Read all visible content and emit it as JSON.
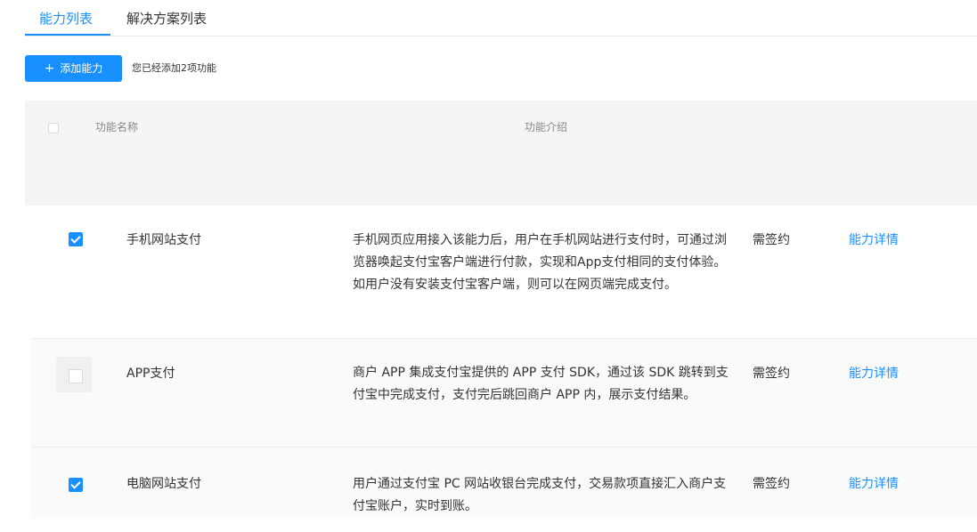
{
  "tabs": [
    {
      "label": "能力列表",
      "active": true
    },
    {
      "label": "解决方案列表",
      "active": false
    }
  ],
  "toolbar": {
    "add_icon": "+",
    "add_label": "添加能力",
    "added_text": "您已经添加2项功能"
  },
  "table": {
    "headers": {
      "name": "功能名称",
      "desc": "功能介绍"
    },
    "rows": [
      {
        "checked": true,
        "name": "手机网站支付",
        "desc": "手机网页应用接入该能力后，用户在手机网站进行支付时，可通过浏览器唤起支付宝客户端进行付款，实现和App支付相同的支付体验。如用户没有安装支付宝客户端，则可以在网页端完成支付。",
        "sign": "需签约",
        "detail": "能力详情"
      },
      {
        "checked": false,
        "name": "APP支付",
        "desc": "商户 APP 集成支付宝提供的 APP 支付 SDK，通过该 SDK 跳转到支付宝中完成支付，支付完后跳回商户 APP 内，展示支付结果。",
        "sign": "需签约",
        "detail": "能力详情"
      },
      {
        "checked": true,
        "name": "电脑网站支付",
        "desc": "用户通过支付宝 PC 网站收银台完成支付，交易款项直接汇入商户支付宝账户，实时到账。",
        "sign": "需签约",
        "detail": "能力详情"
      }
    ]
  },
  "colors": {
    "accent": "#1890ff",
    "header_bg": "#f5f5f5"
  }
}
